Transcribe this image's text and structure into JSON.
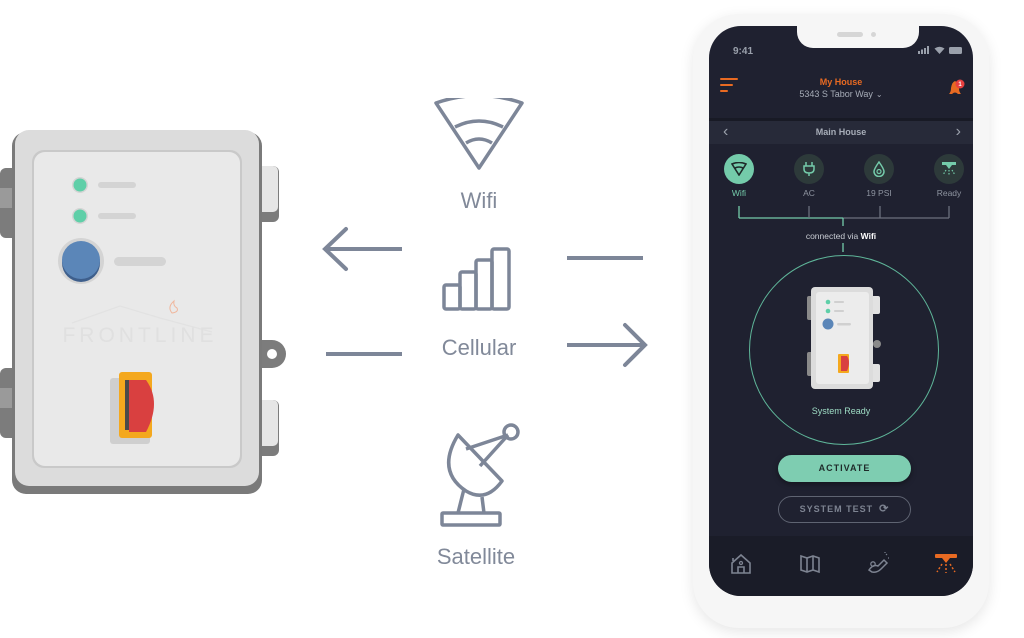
{
  "device": {
    "brand_watermark": "FRONTLINE",
    "led_colors": [
      "#5fcfa8",
      "#5fcfa8"
    ],
    "button_color": "#5b86b8",
    "switch_colors": {
      "base": "#f4a81e",
      "lever": "#d94040"
    }
  },
  "connections": {
    "options": [
      {
        "icon": "wifi-icon",
        "label": "Wifi"
      },
      {
        "icon": "cellular-signal-icon",
        "label": "Cellular"
      },
      {
        "icon": "satellite-dish-icon",
        "label": "Satellite"
      }
    ],
    "arrows": [
      {
        "icon": "arrow-left-icon",
        "direction": "to-device"
      },
      {
        "icon": "arrow-right-icon",
        "direction": "to-phone"
      }
    ]
  },
  "phone": {
    "status_bar": {
      "time": "9:41"
    },
    "header": {
      "title": "My House",
      "address": "5343 S Tabor Way",
      "address_chevron": "⌄",
      "notification_count": "1"
    },
    "house_selector": {
      "name": "Main House",
      "prev": "‹",
      "next": "›"
    },
    "status_items": [
      {
        "icon": "wifi-icon",
        "label": "Wifi",
        "active": true
      },
      {
        "icon": "plug-icon",
        "label": "AC",
        "active": false
      },
      {
        "icon": "water-drop-icon",
        "label": "19 PSI",
        "active": false
      },
      {
        "icon": "sprinkler-icon",
        "label": "Ready",
        "active": false
      }
    ],
    "connected_via": {
      "prefix": "connected via ",
      "method": "Wifi"
    },
    "system_status": "System Ready",
    "buttons": {
      "activate": "ACTIVATE",
      "system_test": "SYSTEM TEST",
      "system_test_icon": "⟳"
    },
    "tabbar": [
      {
        "icon": "home-icon",
        "active": false
      },
      {
        "icon": "map-icon",
        "active": false
      },
      {
        "icon": "hand-spray-icon",
        "active": false
      },
      {
        "icon": "sprinkler-icon",
        "active": true
      }
    ],
    "colors": {
      "accent_orange": "#e86a22",
      "accent_green": "#74cbaa",
      "screen_bg": "#1f2130"
    }
  }
}
